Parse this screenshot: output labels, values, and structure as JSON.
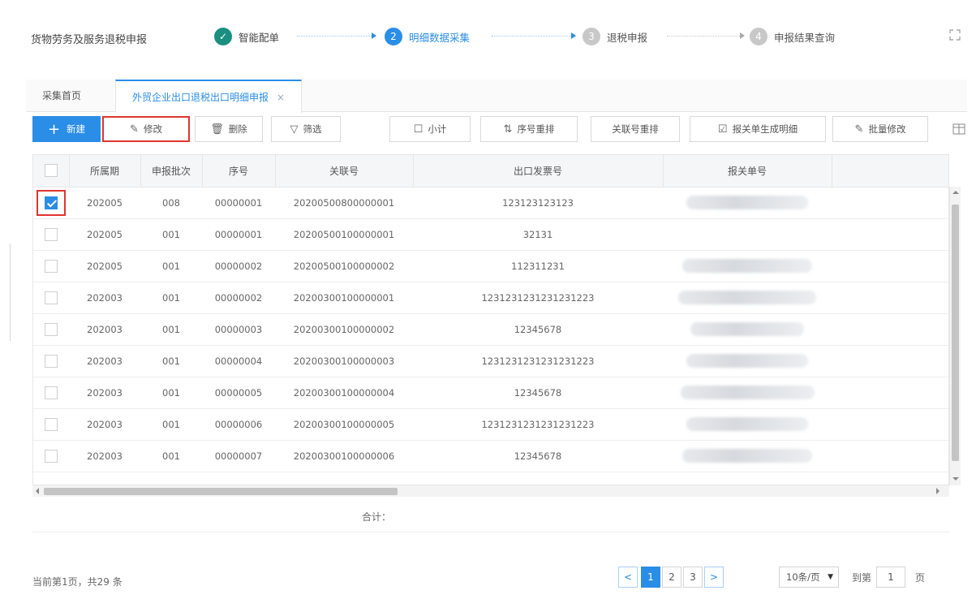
{
  "header": {
    "title": "货物劳务及服务退税申报",
    "steps": [
      {
        "label": "智能配单",
        "state": "done",
        "mark": "✓"
      },
      {
        "label": "明细数据采集",
        "state": "active",
        "mark": "2"
      },
      {
        "label": "退税申报",
        "state": "pending",
        "mark": "3"
      },
      {
        "label": "申报结果查询",
        "state": "pending",
        "mark": "4"
      }
    ]
  },
  "tabs": [
    {
      "label": "采集首页"
    },
    {
      "label": "外贸企业出口退税出口明细申报",
      "close": "×"
    }
  ],
  "toolbar": {
    "new_label": "新建",
    "new_icon": "+",
    "edit_label": "修改",
    "edit_icon": "✎",
    "delete_label": "删除",
    "delete_icon": "🗑",
    "filter_label": "筛选",
    "filter_icon": "▽",
    "subtotal_label": "小计",
    "subtotal_icon": "☐",
    "renumber_label": "序号重排",
    "renumber_icon": "⇅",
    "relno_label": "关联号重排",
    "gen_label": "报关单生成明细",
    "gen_icon": "☑",
    "batch_label": "批量修改",
    "batch_icon": "✎"
  },
  "table": {
    "columns": [
      "所属期",
      "申报批次",
      "序号",
      "关联号",
      "出口发票号",
      "报关单号"
    ],
    "rows": [
      {
        "checked": true,
        "period": "202005",
        "batch": "008",
        "seq": "00000001",
        "rel": "20200500800000001",
        "invoice": "123123123123",
        "customs": true
      },
      {
        "checked": false,
        "period": "202005",
        "batch": "001",
        "seq": "00000001",
        "rel": "20200500100000001",
        "invoice": "32131",
        "customs": false
      },
      {
        "checked": false,
        "period": "202005",
        "batch": "001",
        "seq": "00000002",
        "rel": "20200500100000002",
        "invoice": "112311231",
        "customs": true
      },
      {
        "checked": false,
        "period": "202003",
        "batch": "001",
        "seq": "00000002",
        "rel": "20200300100000001",
        "invoice": "1231231231231231223",
        "customs": true
      },
      {
        "checked": false,
        "period": "202003",
        "batch": "001",
        "seq": "00000003",
        "rel": "20200300100000002",
        "invoice": "12345678",
        "customs": true
      },
      {
        "checked": false,
        "period": "202003",
        "batch": "001",
        "seq": "00000004",
        "rel": "20200300100000003",
        "invoice": "1231231231231231223",
        "customs": true
      },
      {
        "checked": false,
        "period": "202003",
        "batch": "001",
        "seq": "00000005",
        "rel": "20200300100000004",
        "invoice": "12345678",
        "customs": true
      },
      {
        "checked": false,
        "period": "202003",
        "batch": "001",
        "seq": "00000006",
        "rel": "20200300100000005",
        "invoice": "1231231231231231223",
        "customs": true
      },
      {
        "checked": false,
        "period": "202003",
        "batch": "001",
        "seq": "00000007",
        "rel": "20200300100000006",
        "invoice": "12345678",
        "customs": true
      }
    ],
    "total_label": "合计："
  },
  "pagination": {
    "info": "当前第1页，共29 条",
    "prev": "<",
    "next": ">",
    "pages": [
      "1",
      "2",
      "3"
    ],
    "current": "1",
    "page_size": "10条/页",
    "goto_label": "到第",
    "goto_value": "1",
    "suffix": "页"
  },
  "colors": {
    "accent": "#2a8de6",
    "done": "#1a8f7f",
    "highlight": "#e0342e"
  }
}
